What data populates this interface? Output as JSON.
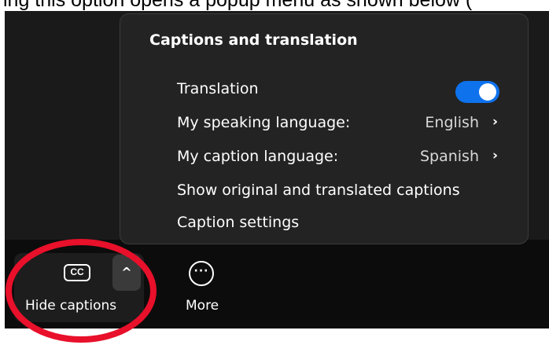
{
  "top_text": "ing this option opens a popup menu as shown below (",
  "menu": {
    "title": "Captions and translation",
    "items": [
      {
        "label": "Translation",
        "toggle_on": true
      },
      {
        "label": "My speaking language:",
        "value": "English"
      },
      {
        "label": "My caption language:",
        "value": "Spanish"
      },
      {
        "label": "Show original and translated captions"
      },
      {
        "label": "Caption settings"
      }
    ],
    "chevron": "›",
    "toggle_color": "#0e72ed"
  },
  "toolbar": {
    "cc_icon_text": "CC",
    "caret": "^",
    "hide_captions_label": "Hide captions",
    "more_icon": "···",
    "more_label": "More"
  },
  "annotation": {
    "color": "#e8102a"
  }
}
